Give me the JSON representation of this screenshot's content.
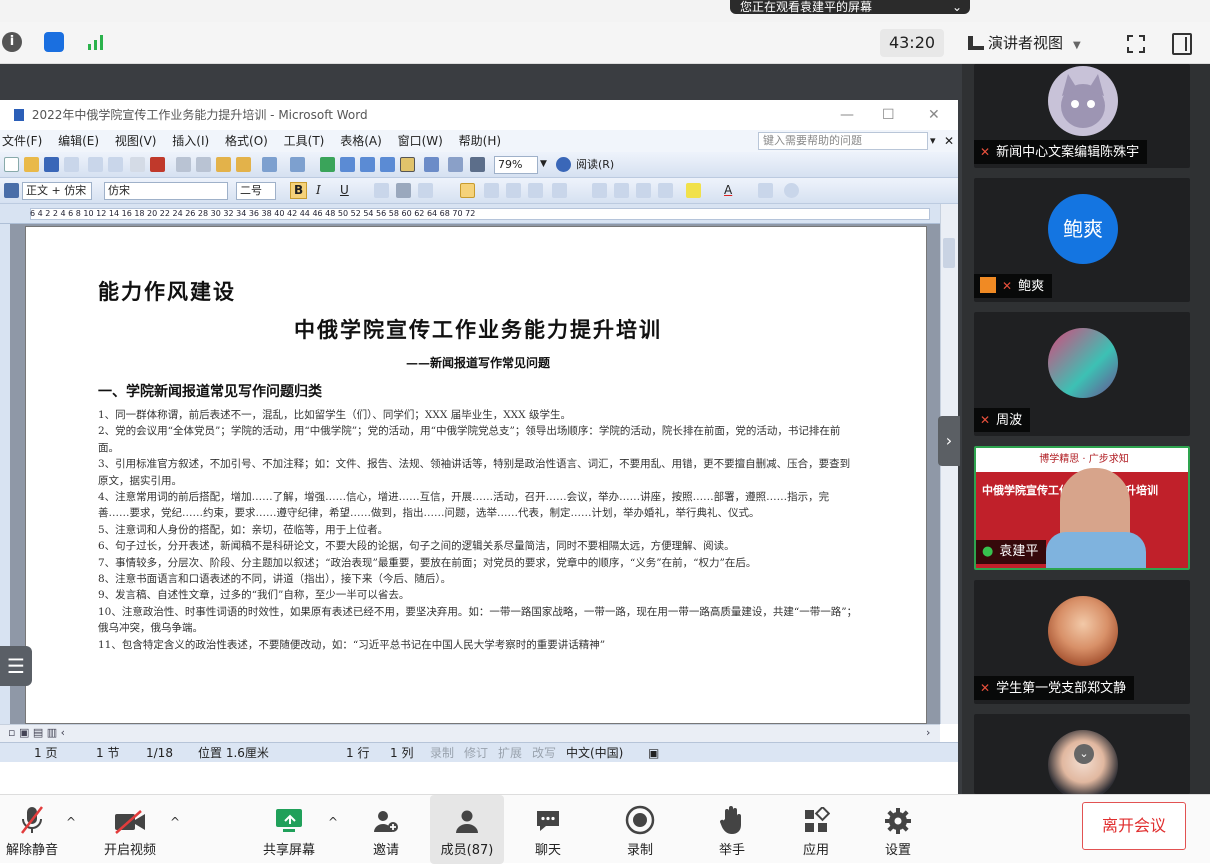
{
  "banner": {
    "text": "您正在观看袁建平的屏幕"
  },
  "meeting_bar": {
    "timer": "43:20",
    "presenter_view": "演讲者视图"
  },
  "word": {
    "window_title": "2022年中俄学院宣传工作业务能力提升培训 - Microsoft Word",
    "menu": [
      "文件(F)",
      "编辑(E)",
      "视图(V)",
      "插入(I)",
      "格式(O)",
      "工具(T)",
      "表格(A)",
      "窗口(W)",
      "帮助(H)"
    ],
    "help_placeholder": "键入需要帮助的问题",
    "zoom": "79%",
    "read_label": "阅读(R)",
    "style_box": "正文 + 仿宋",
    "font_box": "仿宋",
    "size_box": "二号",
    "ruler_numbers": "6  4  2     2  4  6  8  10  12  14  16  18  20  22  24  26  28  30  32  34  36  38  40  42  44  46  48  50  52  54  56  58  60  62  64     68  70  72",
    "status": {
      "page": "1 页",
      "section": "1 节",
      "pages": "1/18",
      "position": "位置 1.6厘米",
      "line": "1 行",
      "col": "1 列",
      "rec": "录制",
      "trk": "修订",
      "ext": "扩展",
      "ovr": "改写",
      "lang": "中文(中国)"
    },
    "doc": {
      "heading0": "能力作风建设",
      "title": "中俄学院宣传工作业务能力提升培训",
      "subtitle": "——新闻报道写作常见问题",
      "section": "一、学院新闻报道常见写作问题归类",
      "items": [
        "1、同一群体称谓，前后表述不一，混乱，比如留学生（们）、同学们；XXX 届毕业生，XXX 级学生。",
        "2、党的会议用“全体党员”；学院的活动，用“中俄学院”；党的活动，用“中俄学院党总支”；领导出场顺序：学院的活动，院长排在前面，党的活动，书记排在前面。",
        "3、引用标准官方叙述，不加引号、不加注释；如：文件、报告、法规、领袖讲话等，特别是政治性语言、词汇，不要用乱、用错，更不要擅自删减、压合，要查到原文，据实引用。",
        "4、注意常用词的前后搭配，增加……了解，增强……信心，增进……互信，开展……活动，召开……会议，举办……讲座，按照……部署，遵照……指示，完善……要求，党纪……约束，要求……遵守纪律，希望……做到，指出……问题，选举……代表，制定……计划，举办婚礼，举行典礼、仪式。",
        "5、注意词和人身份的搭配，如：亲切，莅临等，用于上位者。",
        "6、句子过长，分开表述，新闻稿不是科研论文，不要大段的论据，句子之间的逻辑关系尽量简洁，同时不要相隔太远，方便理解、阅读。",
        "7、事情较多，分层次、阶段、分主题加以叙述；“政治表现”最重要，要放在前面；对党员的要求，党章中的顺序，“义务”在前，“权力”在后。",
        "8、注意书面语言和口语表述的不同，讲道（指出），接下来（今后、随后）。",
        "9、发言稿、自述性文章，过多的“我们”自称，至少一半可以省去。",
        "10、注意政治性、时事性词语的时效性，如果原有表述已经不用，要坚决弃用。如：一带一路国家战略，一带一路，现在用一带一路高质量建设，共建“一带一路”；俄乌冲突，俄乌争端。",
        "11、包含特定含义的政治性表述，不要随便改动，如：“习近平总书记在中国人民大学考察时的重要讲话精神”"
      ]
    }
  },
  "participants": [
    {
      "name": "新闻中心文案编辑陈殊宇",
      "avatar": "cat-avatar"
    },
    {
      "name": "鲍爽",
      "avatar_text": "鲍爽"
    },
    {
      "name": "周波",
      "avatar": "photo"
    },
    {
      "name": "袁建平",
      "video_title": "中俄学院宣传工作业务能力提升培训",
      "video_banner": "博学精思 · 广步求知"
    },
    {
      "name": "学生第一党支部郑文静",
      "avatar": "photo"
    },
    {
      "name": "",
      "avatar": "photo"
    }
  ],
  "bottom_bar": {
    "unmute": "解除静音",
    "start_video": "开启视频",
    "share_screen": "共享屏幕",
    "invite": "邀请",
    "members": "成员(87)",
    "chat": "聊天",
    "record": "录制",
    "raise_hand": "举手",
    "apps": "应用",
    "settings": "设置",
    "leave": "离开会议"
  },
  "colors": {
    "accent_blue": "#1475e1",
    "leave_red": "#e02e2e",
    "share_green": "#20a05a"
  }
}
